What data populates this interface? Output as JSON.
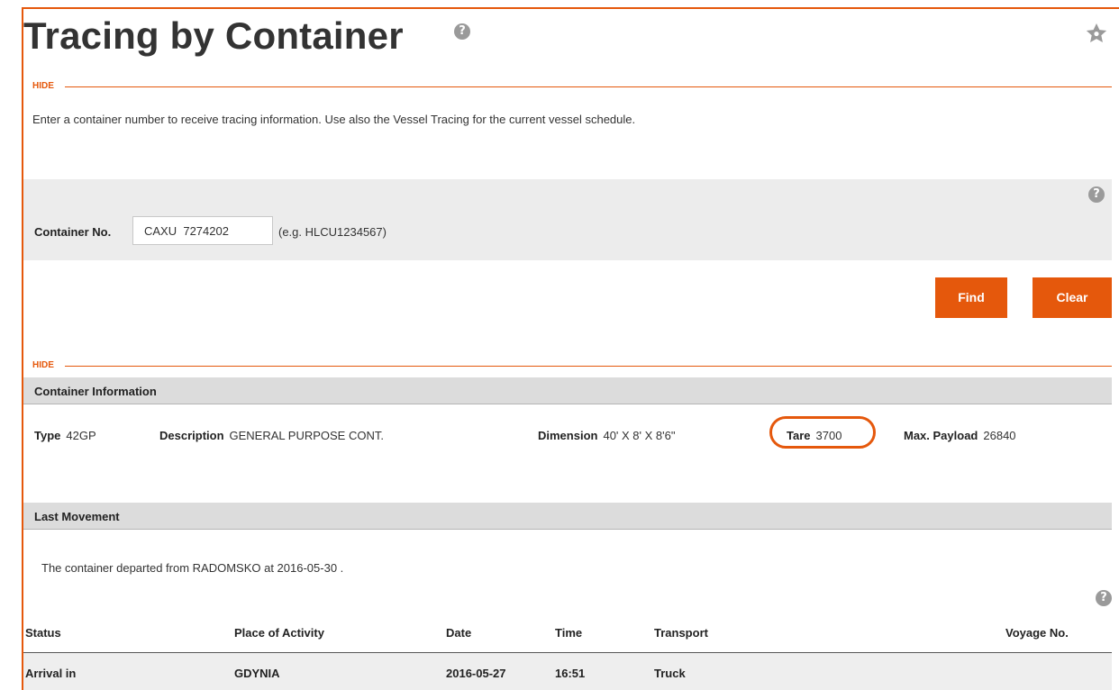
{
  "page": {
    "title": "Tracing by Container",
    "help_glyph": "?",
    "hide_label": "HIDE",
    "intro": "Enter a container number to receive tracing information. Use also the Vessel Tracing for the current vessel schedule."
  },
  "search": {
    "label": "Container No.",
    "value": "CAXU  7274202",
    "hint": "(e.g. HLCU1234567)",
    "find_label": "Find",
    "clear_label": "Clear"
  },
  "container_info": {
    "heading": "Container Information",
    "type_label": "Type",
    "type_value": "42GP",
    "description_label": "Description",
    "description_value": "GENERAL PURPOSE CONT.",
    "dimension_label": "Dimension",
    "dimension_value": "40' X 8' X 8'6\"",
    "tare_label": "Tare",
    "tare_value": "3700",
    "max_payload_label": "Max. Payload",
    "max_payload_value": "26840"
  },
  "last_movement": {
    "heading": "Last Movement",
    "text": "The container departed from RADOMSKO at 2016-05-30 ."
  },
  "table": {
    "columns": [
      "Status",
      "Place of Activity",
      "Date",
      "Time",
      "Transport",
      "Voyage No."
    ],
    "rows": [
      [
        "Arrival in",
        "GDYNIA",
        "2016-05-27",
        "16:51",
        "Truck",
        ""
      ]
    ]
  },
  "colors": {
    "accent": "#e5580c",
    "panel": "#ececec",
    "section_bar": "#dcdcdc"
  },
  "icons": {
    "title_help": "help-icon",
    "favorite": "star-icon"
  }
}
